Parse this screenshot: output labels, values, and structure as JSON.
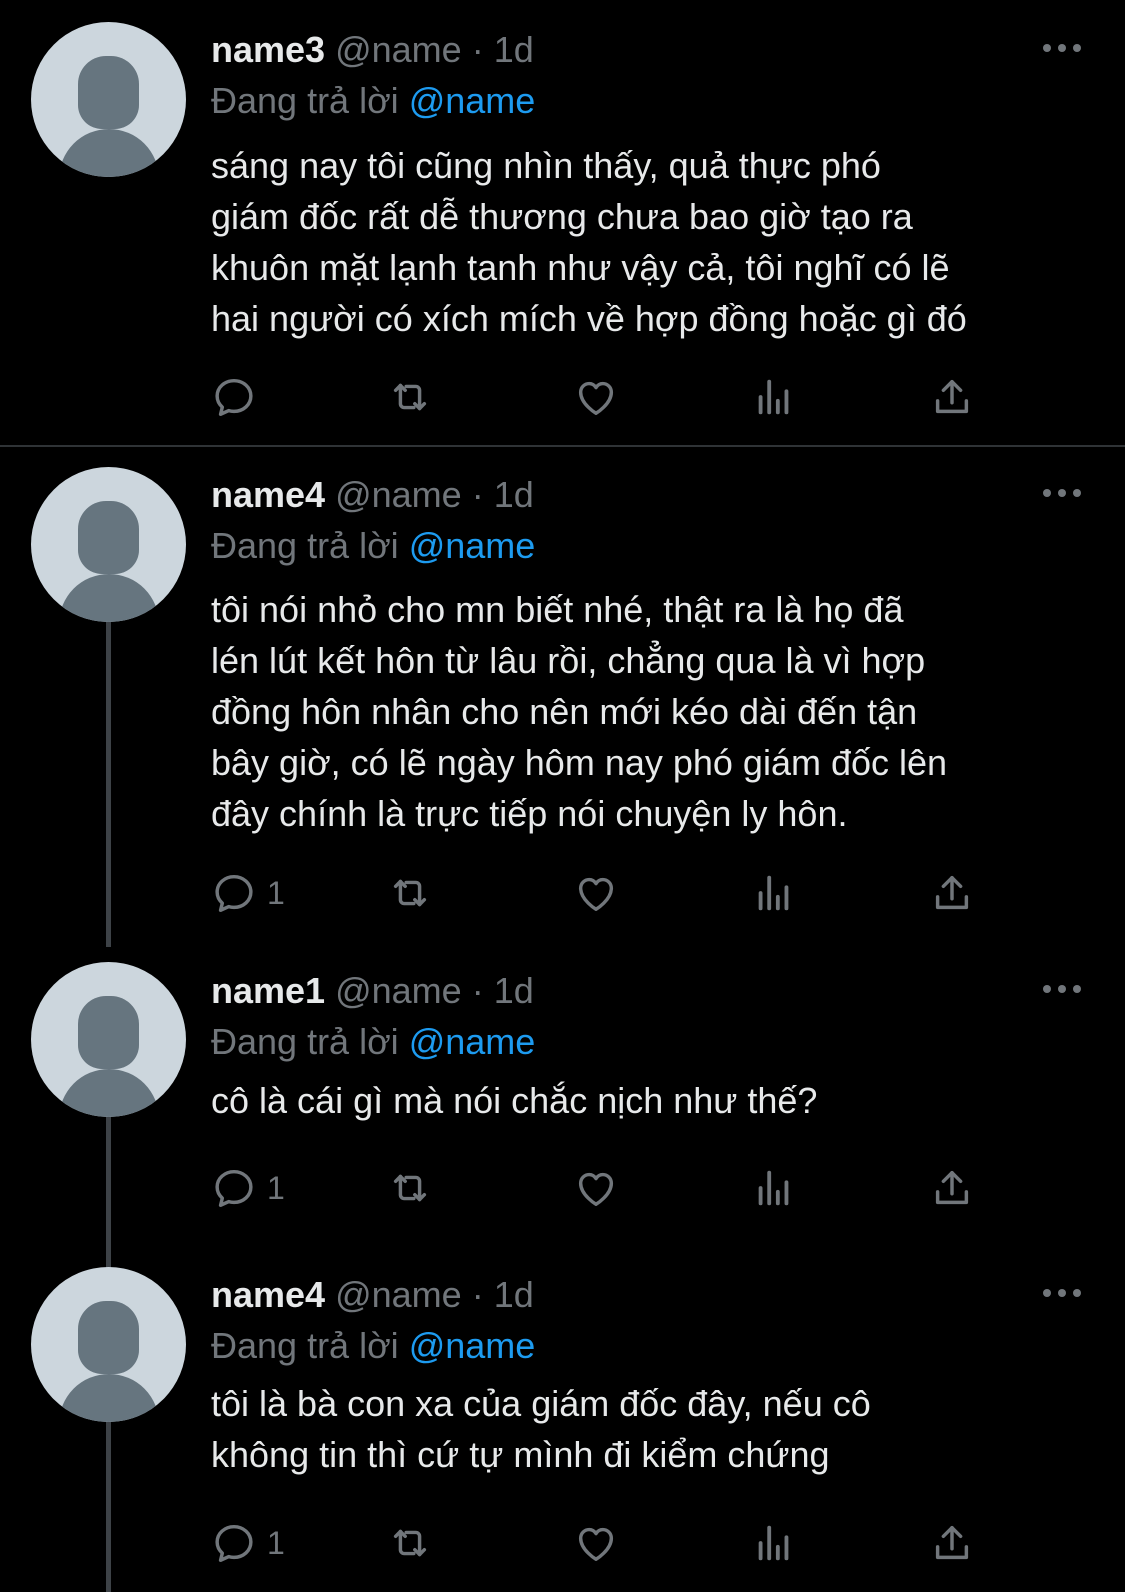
{
  "tweets": [
    {
      "name": "name3",
      "handle": "@name",
      "dot": "·",
      "time": "1d",
      "replying_prefix": "Đang trả lời",
      "replying_to": "@name",
      "lines": [
        "sáng nay tôi cũng nhìn thấy, quả thực phó",
        "giám đốc rất dễ thương chưa bao giờ tạo ra",
        "khuôn mặt lạnh tanh như vậy cả, tôi nghĩ có lẽ",
        "hai người có xích mích về hợp đồng hoặc gì đó"
      ],
      "reply_count": ""
    },
    {
      "name": "name4",
      "handle": "@name",
      "dot": "·",
      "time": "1d",
      "replying_prefix": "Đang trả lời",
      "replying_to": "@name",
      "lines": [
        "tôi nói nhỏ cho mn biết nhé, thật ra là họ đã",
        "lén lút kết hôn từ lâu rồi, chẳng qua là vì hợp",
        "đồng hôn nhân cho nên mới kéo dài đến tận",
        "bây giờ, có lẽ ngày hôm nay phó giám đốc lên",
        "đây chính là trực tiếp nói chuyện ly hôn."
      ],
      "reply_count": "1"
    },
    {
      "name": "name1",
      "handle": "@name",
      "dot": "·",
      "time": "1d",
      "replying_prefix": "Đang trả lời",
      "replying_to": "@name",
      "lines": [
        "cô là cái gì mà nói chắc nịch như thế?"
      ],
      "reply_count": "1"
    },
    {
      "name": "name4",
      "handle": "@name",
      "dot": "·",
      "time": "1d",
      "replying_prefix": "Đang trả lời",
      "replying_to": "@name",
      "lines": [
        "tôi là bà con xa của giám đốc đây, nếu cô",
        "không tin thì cứ tự mình đi kiểm chứng"
      ],
      "reply_count": "1"
    }
  ],
  "icons": [
    "reply-icon",
    "retweet-icon",
    "like-icon",
    "analytics-icon",
    "share-icon",
    "more-icon"
  ],
  "colors": {
    "background": "#000000",
    "text": "#e7e9ea",
    "muted": "#71767b",
    "link": "#1d9bf0",
    "avatar_bg": "#ccd6dd",
    "avatar_fg": "#66757f"
  }
}
